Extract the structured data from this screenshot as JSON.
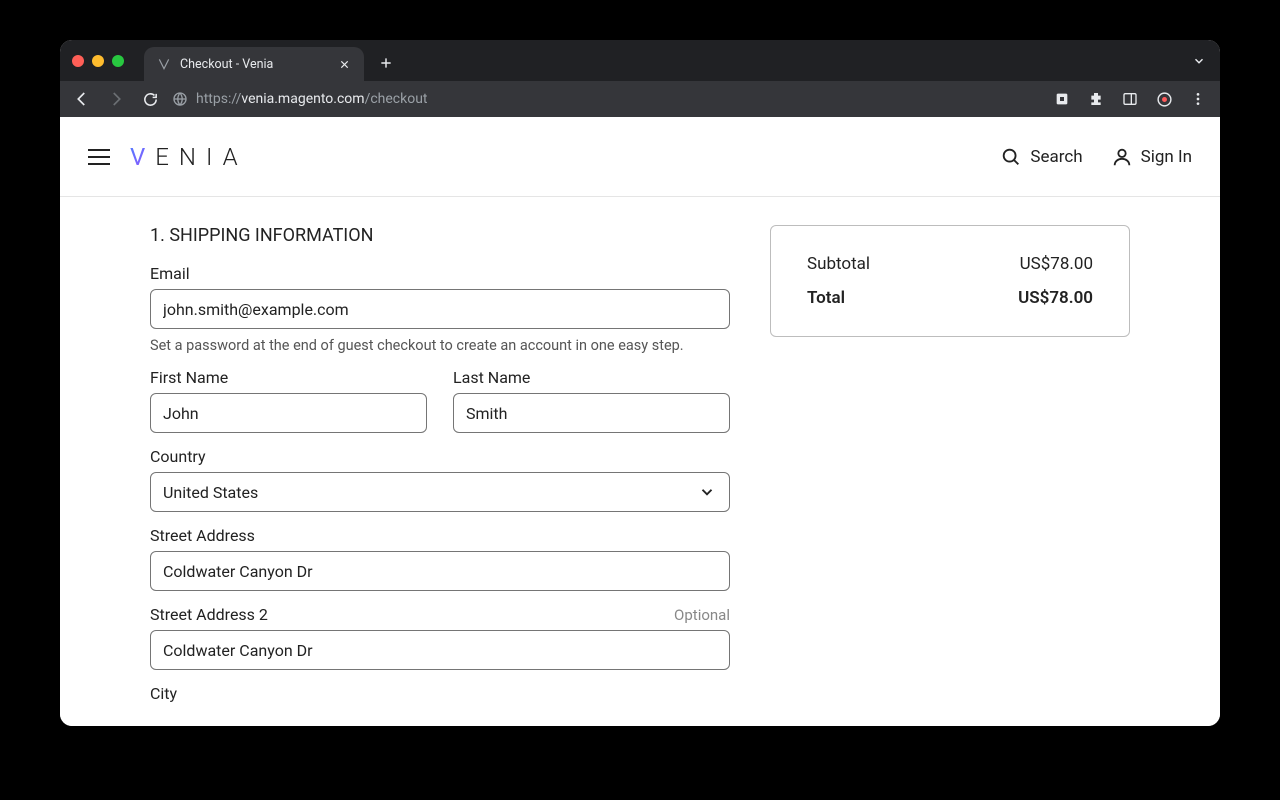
{
  "browser": {
    "tab_title": "Checkout - Venia",
    "url_prefix": "https://",
    "url_host": "venia.magento.com",
    "url_path": "/checkout"
  },
  "header": {
    "logo_text": "ENIA",
    "search_label": "Search",
    "signin_label": "Sign In"
  },
  "form": {
    "section_title": "1. SHIPPING INFORMATION",
    "email_label": "Email",
    "email_value": "john.smith@example.com",
    "email_hint": "Set a password at the end of guest checkout to create an account in one easy step.",
    "first_name_label": "First Name",
    "first_name_value": "John",
    "last_name_label": "Last Name",
    "last_name_value": "Smith",
    "country_label": "Country",
    "country_value": "United States",
    "street1_label": "Street Address",
    "street1_value": "Coldwater Canyon Dr",
    "street2_label": "Street Address 2",
    "street2_optional": "Optional",
    "street2_value": "Coldwater Canyon Dr",
    "city_label": "City"
  },
  "summary": {
    "subtotal_label": "Subtotal",
    "subtotal_value": "US$78.00",
    "total_label": "Total",
    "total_value": "US$78.00"
  }
}
